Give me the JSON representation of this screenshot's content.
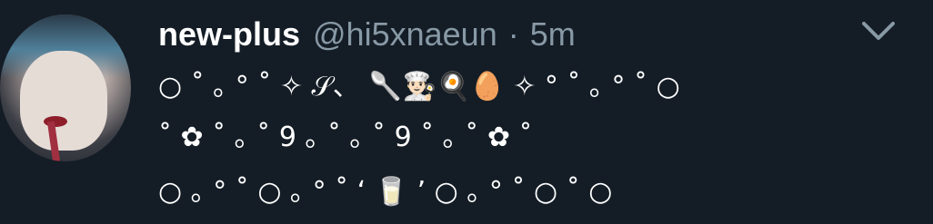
{
  "tweet": {
    "display_name": "new-plus",
    "handle": "@hi5xnaeun",
    "separator": "·",
    "time": "5m",
    "lines": [
      "○ ˚ ｡ ° ˚ ✧ 𝒮、 🥄👨🏻‍🍳🍳🥚 ✧ ° ˚ ｡ ° ˚ ○",
      "˚ ✿ ˚ ｡ ˚ 9 ｡ ˚ ｡ ˚ 9 ˚ ｡ ˚ ✿ ˚",
      "○ ｡ ° ˚ ○ ｡ ° ˚ ‘ 🥛 ’ ○ ｡ ° ˚ ○ ˚ ○"
    ]
  },
  "icons": {
    "avatar": "profile-avatar",
    "menu": "chevron-down-icon"
  },
  "colors": {
    "background": "#141d26",
    "muted": "#8899a6",
    "text": "#ffffff"
  }
}
